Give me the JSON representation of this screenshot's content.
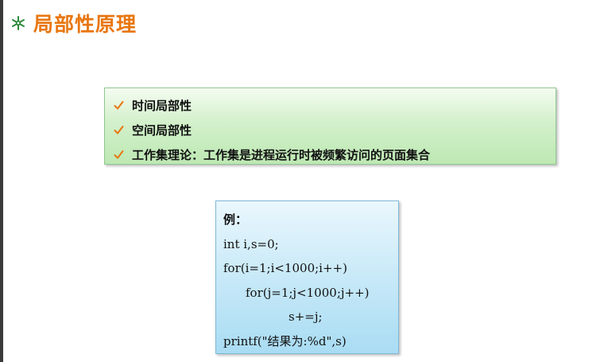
{
  "title": "局部性原理",
  "bullets": [
    "时间局部性",
    "空间局部性",
    "工作集理论：工作集是进程运行时被频繁访问的页面集合"
  ],
  "example": {
    "label": "例：",
    "code": [
      "int i,s=0;",
      "for(i=1;i<1000;i++)",
      "for(j=1;j<1000;j++)",
      "s+=j;",
      "printf(\"结果为:%d\",s)"
    ]
  },
  "colors": {
    "title": "#e8760f",
    "bullet_icon": "#2e8b3a",
    "check": "#e8760f"
  },
  "icons": {
    "title_bullet": "snowflake-bullet-icon",
    "list_bullet": "checkmark-icon"
  }
}
